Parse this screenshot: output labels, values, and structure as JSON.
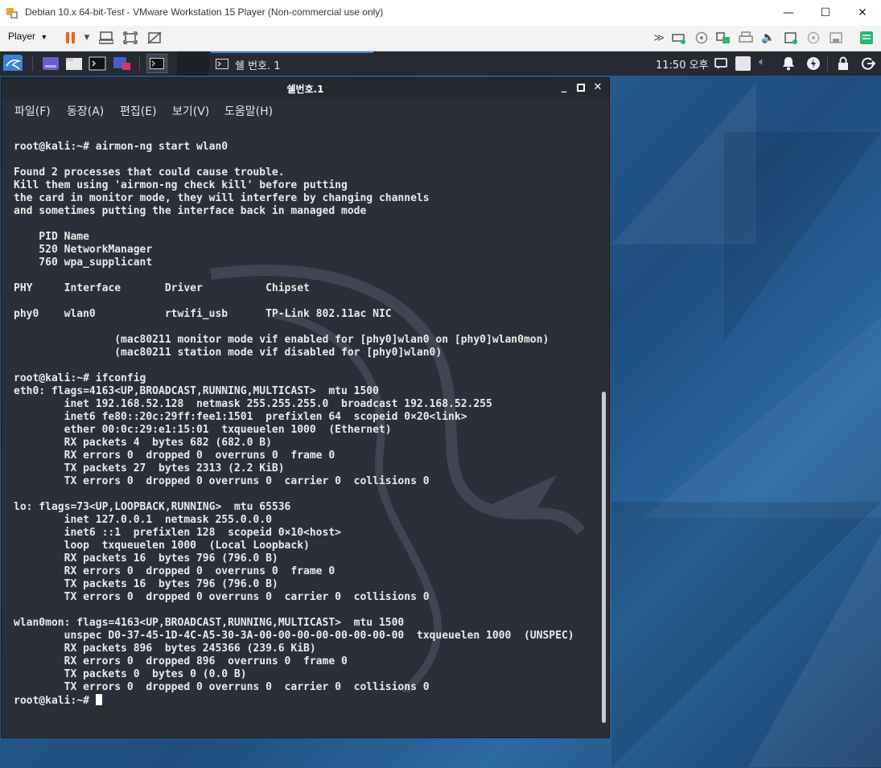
{
  "host_window": {
    "title": "Debian 10.x 64-bit-Test - VMware Workstation 15 Player (Non-commercial use only)",
    "controls": {
      "minimize": "—",
      "maximize": "☐",
      "close": "✕"
    }
  },
  "host_toolbar": {
    "player_label": "Player",
    "icons": [
      "pause-icon",
      "dropdown-icon",
      "send-ctrl-alt-del-icon",
      "fit-guest-icon",
      "unity-icon",
      "fast-forward-icon",
      "network-adapter-icon",
      "cd-icon",
      "usb-icon",
      "printer-icon",
      "sound-icon",
      "hard-disk-icon",
      "cd2-icon",
      "floppy-icon",
      "message-icon"
    ]
  },
  "guest_panel": {
    "task_label": "쉘 번호. 1",
    "clock": "11:50 오후"
  },
  "terminal": {
    "title": "쉘번호.1",
    "menu": [
      "파일(F)",
      "동장(A)",
      "편집(E)",
      "보기(V)",
      "도움말(H)"
    ],
    "output": "root@kali:~# airmon-ng start wlan0\n\nFound 2 processes that could cause trouble.\nKill them using 'airmon-ng check kill' before putting\nthe card in monitor mode, they will interfere by changing channels\nand sometimes putting the interface back in managed mode\n\n    PID Name\n    520 NetworkManager\n    760 wpa_supplicant\n\nPHY     Interface       Driver          Chipset\n\nphy0    wlan0           rtwifi_usb      TP-Link 802.11ac NIC\n\n                (mac80211 monitor mode vif enabled for [phy0]wlan0 on [phy0]wlan0mon)\n                (mac80211 station mode vif disabled for [phy0]wlan0)\n\nroot@kali:~# ifconfig\neth0: flags=4163<UP,BROADCAST,RUNNING,MULTICAST>  mtu 1500\n        inet 192.168.52.128  netmask 255.255.255.0  broadcast 192.168.52.255\n        inet6 fe80::20c:29ff:fee1:1501  prefixlen 64  scopeid 0×20<link>\n        ether 00:0c:29:e1:15:01  txqueuelen 1000  (Ethernet)\n        RX packets 4  bytes 682 (682.0 B)\n        RX errors 0  dropped 0  overruns 0  frame 0\n        TX packets 27  bytes 2313 (2.2 KiB)\n        TX errors 0  dropped 0 overruns 0  carrier 0  collisions 0\n\nlo: flags=73<UP,LOOPBACK,RUNNING>  mtu 65536\n        inet 127.0.0.1  netmask 255.0.0.0\n        inet6 ::1  prefixlen 128  scopeid 0×10<host>\n        loop  txqueuelen 1000  (Local Loopback)\n        RX packets 16  bytes 796 (796.0 B)\n        RX errors 0  dropped 0  overruns 0  frame 0\n        TX packets 16  bytes 796 (796.0 B)\n        TX errors 0  dropped 0 overruns 0  carrier 0  collisions 0\n\nwlan0mon: flags=4163<UP,BROADCAST,RUNNING,MULTICAST>  mtu 1500\n        unspec D0-37-45-1D-4C-A5-30-3A-00-00-00-00-00-00-00-00  txqueuelen 1000  (UNSPEC)\n        RX packets 896  bytes 245366 (239.6 KiB)\n        RX errors 0  dropped 896  overruns 0  frame 0\n        TX packets 0  bytes 0 (0.0 B)\n        TX errors 0  dropped 0 overruns 0  carrier 0  collisions 0\n",
    "prompt": "root@kali:~# ",
    "scroll_position": 0.58
  },
  "colors": {
    "terminal_bg": "#2b2f3a",
    "accent": "#3b82d6",
    "vmware_pause": "#e8671c",
    "note_icon": "#2bb673"
  }
}
